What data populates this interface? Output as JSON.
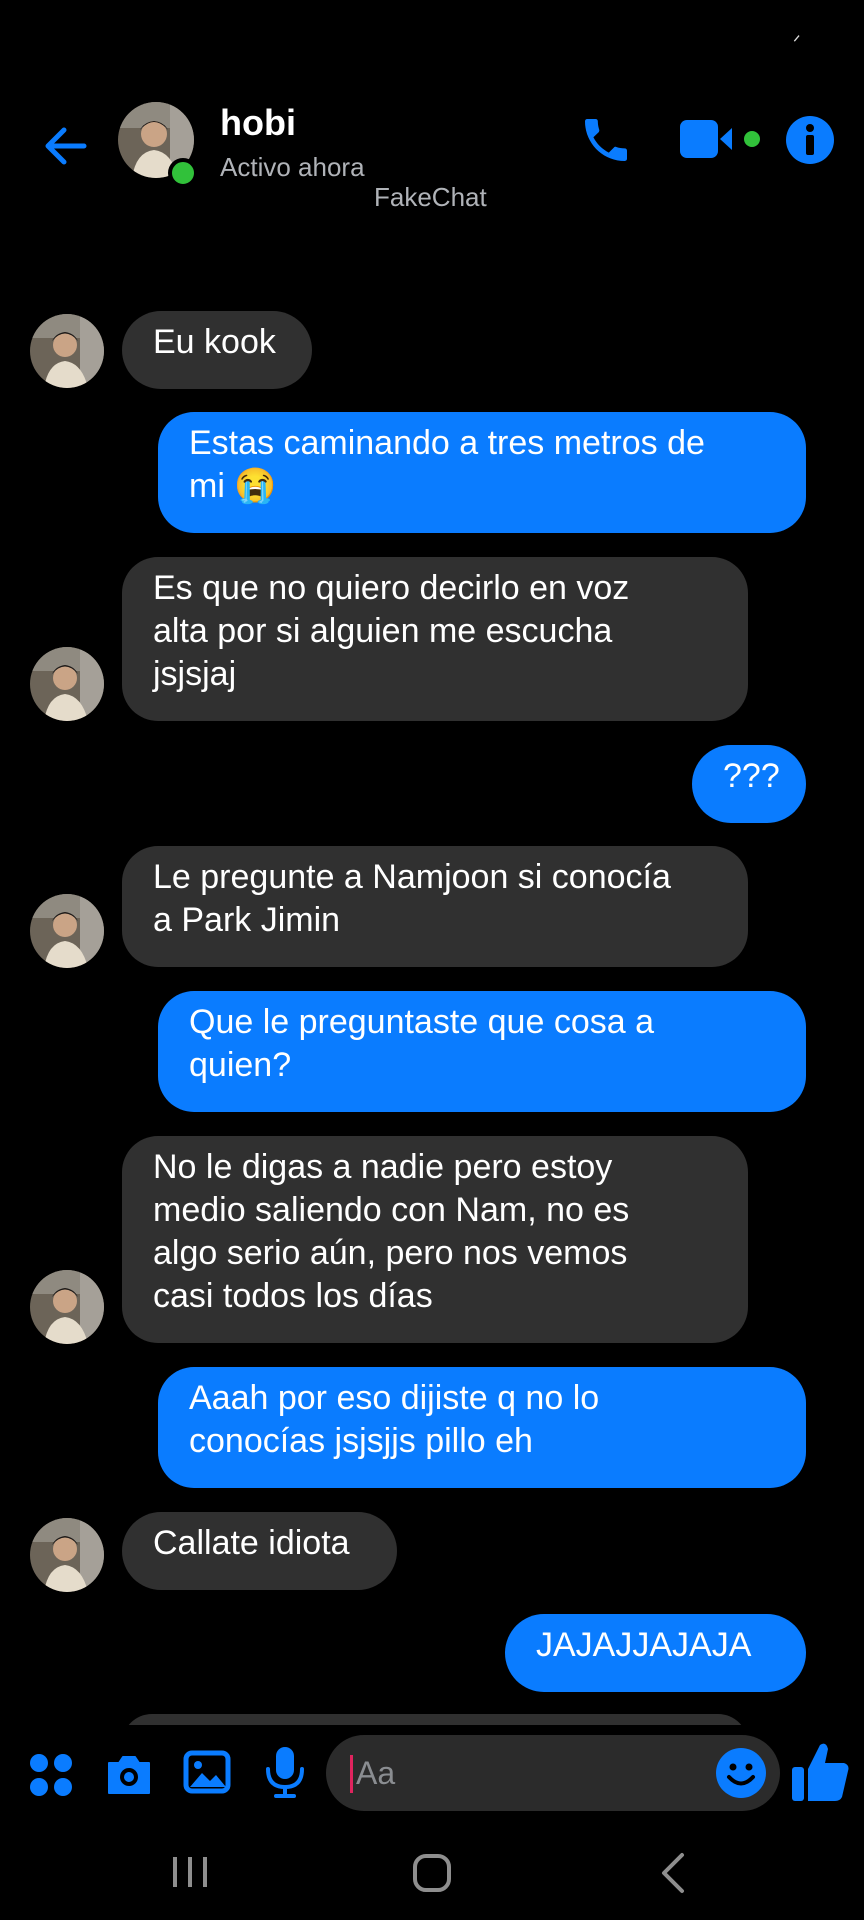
{
  "status_bar": {
    "mark": "ᐟ"
  },
  "header": {
    "name": "hobi",
    "status": "Activo ahora",
    "watermark": "FakeChat"
  },
  "messages": [
    {
      "dir": "in",
      "lines": [
        "Eu kook"
      ]
    },
    {
      "dir": "out",
      "lines": [
        "Estas caminando a tres metros de",
        "mi 😭"
      ]
    },
    {
      "dir": "in",
      "lines": [
        "Es que no quiero decirlo en voz",
        "alta por si alguien me escucha",
        "jsjsjaj"
      ]
    },
    {
      "dir": "out",
      "lines": [
        "???"
      ]
    },
    {
      "dir": "in",
      "lines": [
        "Le pregunte a Namjoon si conocía",
        "a Park Jimin"
      ]
    },
    {
      "dir": "out",
      "lines": [
        "Que le preguntaste que cosa a",
        "quien?"
      ]
    },
    {
      "dir": "in",
      "lines": [
        "No le digas a nadie pero estoy",
        "medio saliendo con Nam, no es",
        "algo serio aún, pero nos vemos",
        "casi todos los días"
      ]
    },
    {
      "dir": "out",
      "lines": [
        "Aaah por eso dijiste q no lo",
        "conocías jsjsjjs pillo eh"
      ]
    },
    {
      "dir": "in",
      "lines": [
        "Callate idiota"
      ]
    },
    {
      "dir": "out",
      "lines": [
        "JAJAJJAJAJA"
      ]
    }
  ],
  "composer": {
    "placeholder": "Aa"
  },
  "colors": {
    "accent": "#0a7cff",
    "incoming_bubble": "#303030",
    "online": "#31c13a",
    "background": "#000000"
  },
  "icons": [
    "back-arrow-icon",
    "phone-icon",
    "video-camera-icon",
    "info-icon",
    "apps-grid-icon",
    "camera-icon",
    "image-icon",
    "microphone-icon",
    "emoji-icon",
    "thumbs-up-icon",
    "recents-icon",
    "home-icon",
    "back-nav-icon"
  ]
}
